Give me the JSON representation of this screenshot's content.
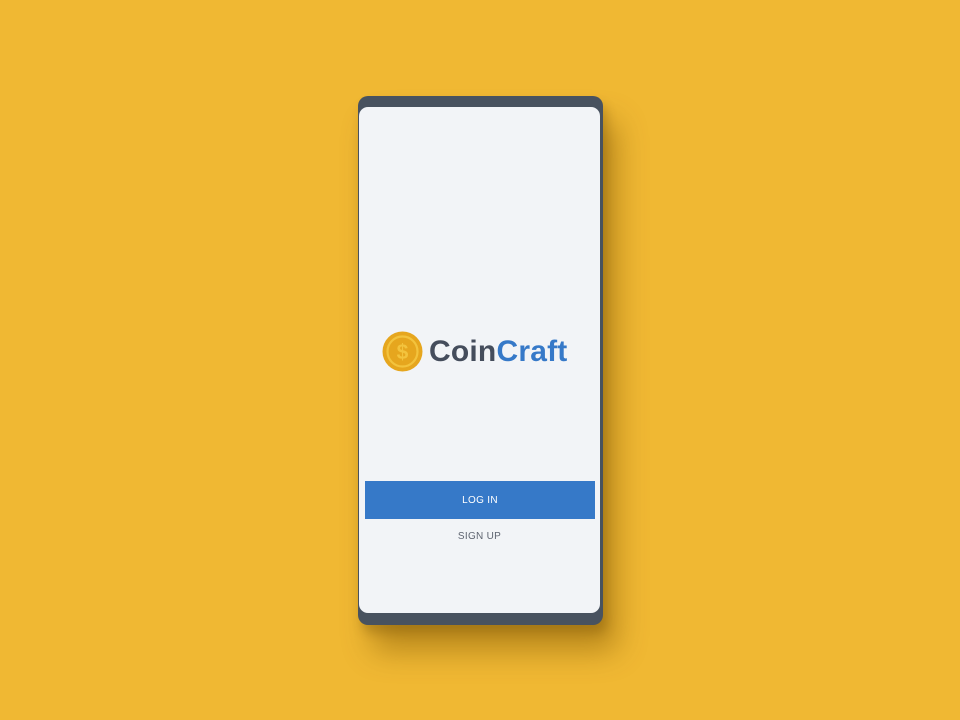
{
  "colors": {
    "background": "#F0B833",
    "device_frame": "#48525F",
    "screen_background": "#F2F4F7",
    "coin_outer": "#E6A61E",
    "coin_inner": "#F3C33D",
    "brand_dark": "#454D5C",
    "brand_accent": "#3679C8",
    "button_text": "#FFFFFF",
    "link_text": "#5E6470"
  },
  "logo": {
    "icon": "dollar-coin-icon",
    "coin_symbol": "$",
    "brand_part1": "Coin",
    "brand_part2": "Craft"
  },
  "auth": {
    "login_label": "LOG IN",
    "signup_label": "SIGN UP"
  }
}
